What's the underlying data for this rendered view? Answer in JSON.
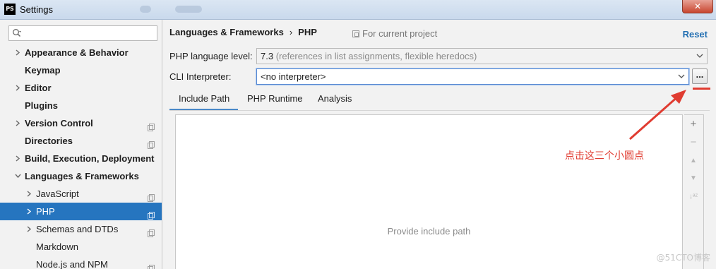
{
  "window": {
    "title": "Settings",
    "app_icon_text": "PS",
    "close_glyph": "✕"
  },
  "sidebar": {
    "search_placeholder": "",
    "items": [
      {
        "label": "Appearance & Behavior",
        "bold": true,
        "arrow": "right",
        "indent": 0,
        "page_icon": false
      },
      {
        "label": "Keymap",
        "bold": true,
        "arrow": "none",
        "indent": 0,
        "page_icon": false
      },
      {
        "label": "Editor",
        "bold": true,
        "arrow": "right",
        "indent": 0,
        "page_icon": false
      },
      {
        "label": "Plugins",
        "bold": true,
        "arrow": "none",
        "indent": 0,
        "page_icon": false
      },
      {
        "label": "Version Control",
        "bold": true,
        "arrow": "right",
        "indent": 0,
        "page_icon": true
      },
      {
        "label": "Directories",
        "bold": true,
        "arrow": "none",
        "indent": 0,
        "page_icon": true
      },
      {
        "label": "Build, Execution, Deployment",
        "bold": true,
        "arrow": "right",
        "indent": 0,
        "page_icon": false
      },
      {
        "label": "Languages & Frameworks",
        "bold": true,
        "arrow": "down",
        "indent": 0,
        "page_icon": false
      },
      {
        "label": "JavaScript",
        "bold": false,
        "arrow": "right",
        "indent": 1,
        "page_icon": true
      },
      {
        "label": "PHP",
        "bold": false,
        "arrow": "right",
        "indent": 1,
        "page_icon": true,
        "selected": true
      },
      {
        "label": "Schemas and DTDs",
        "bold": false,
        "arrow": "right",
        "indent": 1,
        "page_icon": true
      },
      {
        "label": "Markdown",
        "bold": false,
        "arrow": "none",
        "indent": 1,
        "page_icon": false
      },
      {
        "label": "Node.js and NPM",
        "bold": false,
        "arrow": "none",
        "indent": 1,
        "page_icon": true
      }
    ]
  },
  "header": {
    "breadcrumb_parent": "Languages & Frameworks",
    "breadcrumb_separator": "›",
    "breadcrumb_current": "PHP",
    "scope_text": "For current project",
    "reset_label": "Reset"
  },
  "form": {
    "language_level_label": "PHP language level:",
    "language_level_value": "7.3",
    "language_level_hint": "(references in list assignments, flexible heredocs)",
    "cli_label": "CLI Interpreter:",
    "cli_value": "<no interpreter>",
    "browse_label": "..."
  },
  "tabs": [
    {
      "label": "Include Path",
      "active": true
    },
    {
      "label": "PHP Runtime",
      "active": false
    },
    {
      "label": "Analysis",
      "active": false
    }
  ],
  "include_path": {
    "empty_text": "Provide include path",
    "toolbar": [
      {
        "icon": "plus-icon",
        "glyph": "+",
        "enabled": true
      },
      {
        "icon": "minus-icon",
        "glyph": "−",
        "enabled": false
      },
      {
        "icon": "move-up-icon",
        "glyph": "▲",
        "enabled": false
      },
      {
        "icon": "move-down-icon",
        "glyph": "▼",
        "enabled": false
      },
      {
        "icon": "sort-az-icon",
        "glyph": "↓ᵃᶻ",
        "enabled": false
      }
    ]
  },
  "annotation": {
    "text": "点击这三个小圆点",
    "color": "#e03c31"
  },
  "watermark": "@51CTO博客",
  "colors": {
    "selection": "#2675bf",
    "accent_link": "#2470b3",
    "annotation_red": "#e03c31"
  }
}
